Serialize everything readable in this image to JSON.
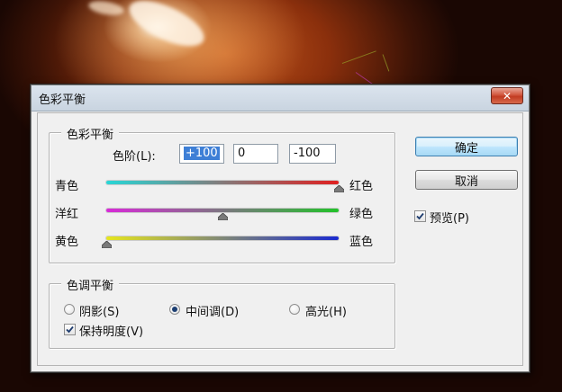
{
  "dialog": {
    "title": "色彩平衡",
    "close_glyph": "✕"
  },
  "color_balance": {
    "group_title": "色彩平衡",
    "levels_label": "色阶(L):",
    "levels": [
      "+100",
      "0",
      "-100"
    ],
    "sliders": [
      {
        "left": "青色",
        "right": "红色",
        "value": 100,
        "colors": [
          "#28d6d6",
          "#e02020"
        ]
      },
      {
        "left": "洋红",
        "right": "绿色",
        "value": 0,
        "colors": [
          "#d82ad8",
          "#22c22a"
        ]
      },
      {
        "left": "黄色",
        "right": "蓝色",
        "value": -100,
        "colors": [
          "#e6e61e",
          "#1a2ad0"
        ]
      }
    ]
  },
  "tone_balance": {
    "group_title": "色调平衡",
    "options": [
      {
        "label": "阴影(S)",
        "checked": false
      },
      {
        "label": "中间调(D)",
        "checked": true
      },
      {
        "label": "高光(H)",
        "checked": false
      }
    ],
    "preserve_luminosity": {
      "label": "保持明度(V)",
      "checked": true
    }
  },
  "buttons": {
    "ok": "确定",
    "cancel": "取消"
  },
  "preview": {
    "label": "预览(P)",
    "checked": true
  }
}
